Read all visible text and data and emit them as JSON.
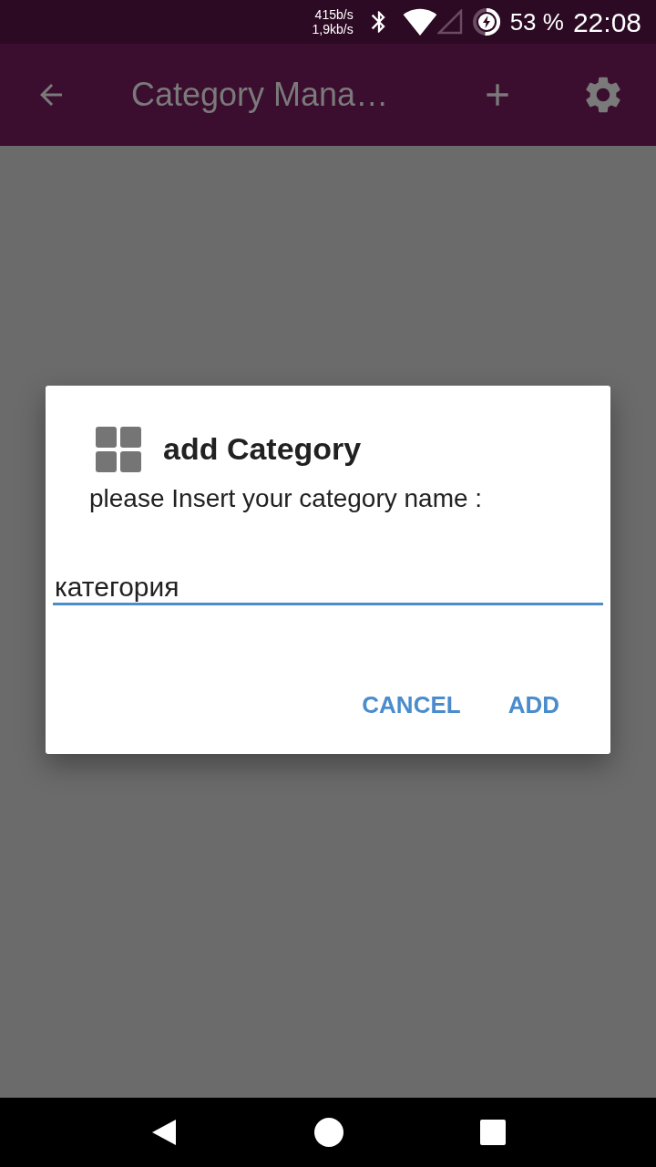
{
  "status_bar": {
    "net_up": "415b/s",
    "net_down": "1,9kb/s",
    "battery": "53 %",
    "time": "22:08"
  },
  "app_bar": {
    "title": "Category Mana…"
  },
  "dialog": {
    "title": "add Category",
    "message": "please Insert your category name :",
    "field": {
      "value": "категория",
      "focused": true
    },
    "buttons": [
      {
        "label": "CANCEL"
      },
      {
        "label": "ADD"
      }
    ]
  }
}
